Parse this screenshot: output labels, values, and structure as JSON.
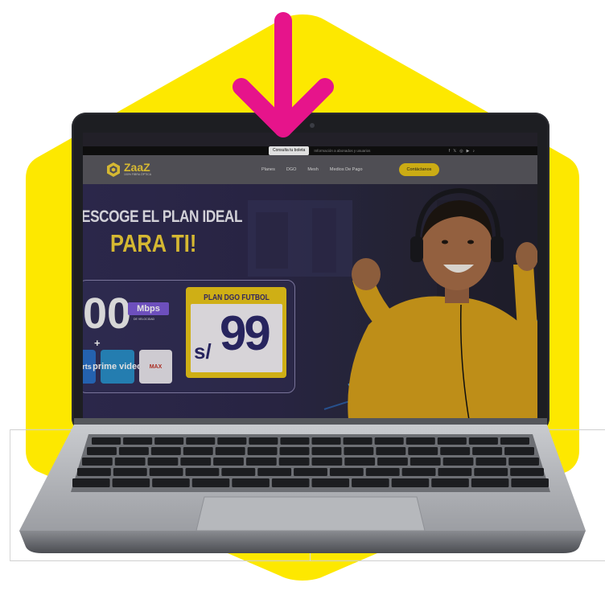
{
  "colors": {
    "hexagon_yellow": "#fde800",
    "arrow_magenta": "#e6148b",
    "brand_yellow": "#f3d23a",
    "plan_text": "#2d2a6c"
  },
  "icons": {
    "pointer": "down-arrow-icon",
    "social": [
      "facebook-icon",
      "x-icon",
      "instagram-icon",
      "youtube-icon",
      "tiktok-icon"
    ],
    "logo": "zaaz-hex-logo-icon"
  },
  "site": {
    "topbar": {
      "button_label": "Consulta tu boleta",
      "message": "Información a abonados y usuarios",
      "social_glyphs": [
        "f",
        "𝕏",
        "◎",
        "▶",
        "♪"
      ]
    },
    "logo": {
      "name": "ZaaZ",
      "tagline": "100% FIBRA ÓPTICA"
    },
    "nav": {
      "links": [
        "Planes",
        "DGO",
        "Mesh",
        "Medios De Pago"
      ],
      "cta": "Contáctanos"
    },
    "hero": {
      "title_line1": "ESCOGE EL PLAN IDEAL",
      "title_line2": "PARA TI!",
      "speed_value": "00",
      "speed_unit": "Mbps",
      "speed_caption": "DE VELOCIDAD",
      "plus": "+",
      "apps": [
        "rts",
        "prime video",
        "MAX"
      ],
      "plan_label": "PLAN DGO FUTBOL",
      "plan_currency": "s/",
      "plan_price": "99"
    }
  }
}
